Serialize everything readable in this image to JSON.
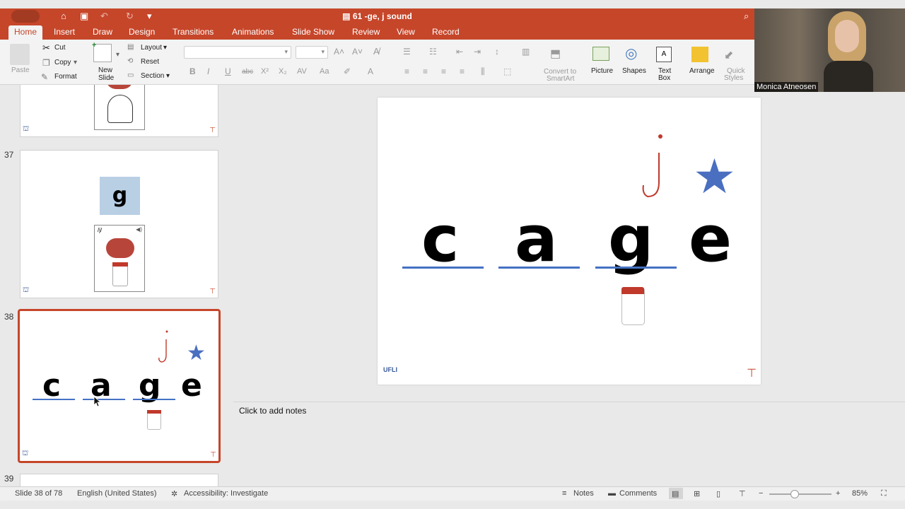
{
  "window": {
    "title": "61 -ge, j sound"
  },
  "tabs": [
    {
      "label": "Home"
    },
    {
      "label": "Insert"
    },
    {
      "label": "Draw"
    },
    {
      "label": "Design"
    },
    {
      "label": "Transitions"
    },
    {
      "label": "Animations"
    },
    {
      "label": "Slide Show"
    },
    {
      "label": "Review"
    },
    {
      "label": "View"
    },
    {
      "label": "Record"
    }
  ],
  "ribbon": {
    "paste": "Paste",
    "cut": "Cut",
    "copy": "Copy",
    "format": "Format",
    "new_slide_1": "New",
    "new_slide_2": "Slide",
    "layout": "Layout",
    "reset": "Reset",
    "section": "Section",
    "convert_1": "Convert to",
    "convert_2": "SmartArt",
    "picture": "Picture",
    "shapes": "Shapes",
    "textbox_1": "Text",
    "textbox_2": "Box",
    "arrange": "Arrange",
    "quick_styles_1": "Quick",
    "quick_styles_2": "Styles"
  },
  "thumbnails": [
    {
      "number": "37",
      "card_letter": "g",
      "card_code": "/j/"
    },
    {
      "number": "38",
      "letters": [
        "c",
        "a",
        "g",
        "e"
      ]
    },
    {
      "number": "39"
    }
  ],
  "slide": {
    "letters": [
      "c",
      "a",
      "g",
      "e"
    ],
    "marker": "j",
    "logo_text": "UFLI"
  },
  "notes": {
    "placeholder": "Click to add notes"
  },
  "status": {
    "slide_info": "Slide 38 of 78",
    "language": "English (United States)",
    "accessibility": "Accessibility: Investigate",
    "notes": "Notes",
    "comments": "Comments",
    "zoom": "85%"
  },
  "video": {
    "participant": "Monica Atneosen"
  },
  "colors": {
    "accent": "#c6462a",
    "underline": "#4472c4",
    "star": "#4a6fc0",
    "hook": "#c0392b"
  }
}
